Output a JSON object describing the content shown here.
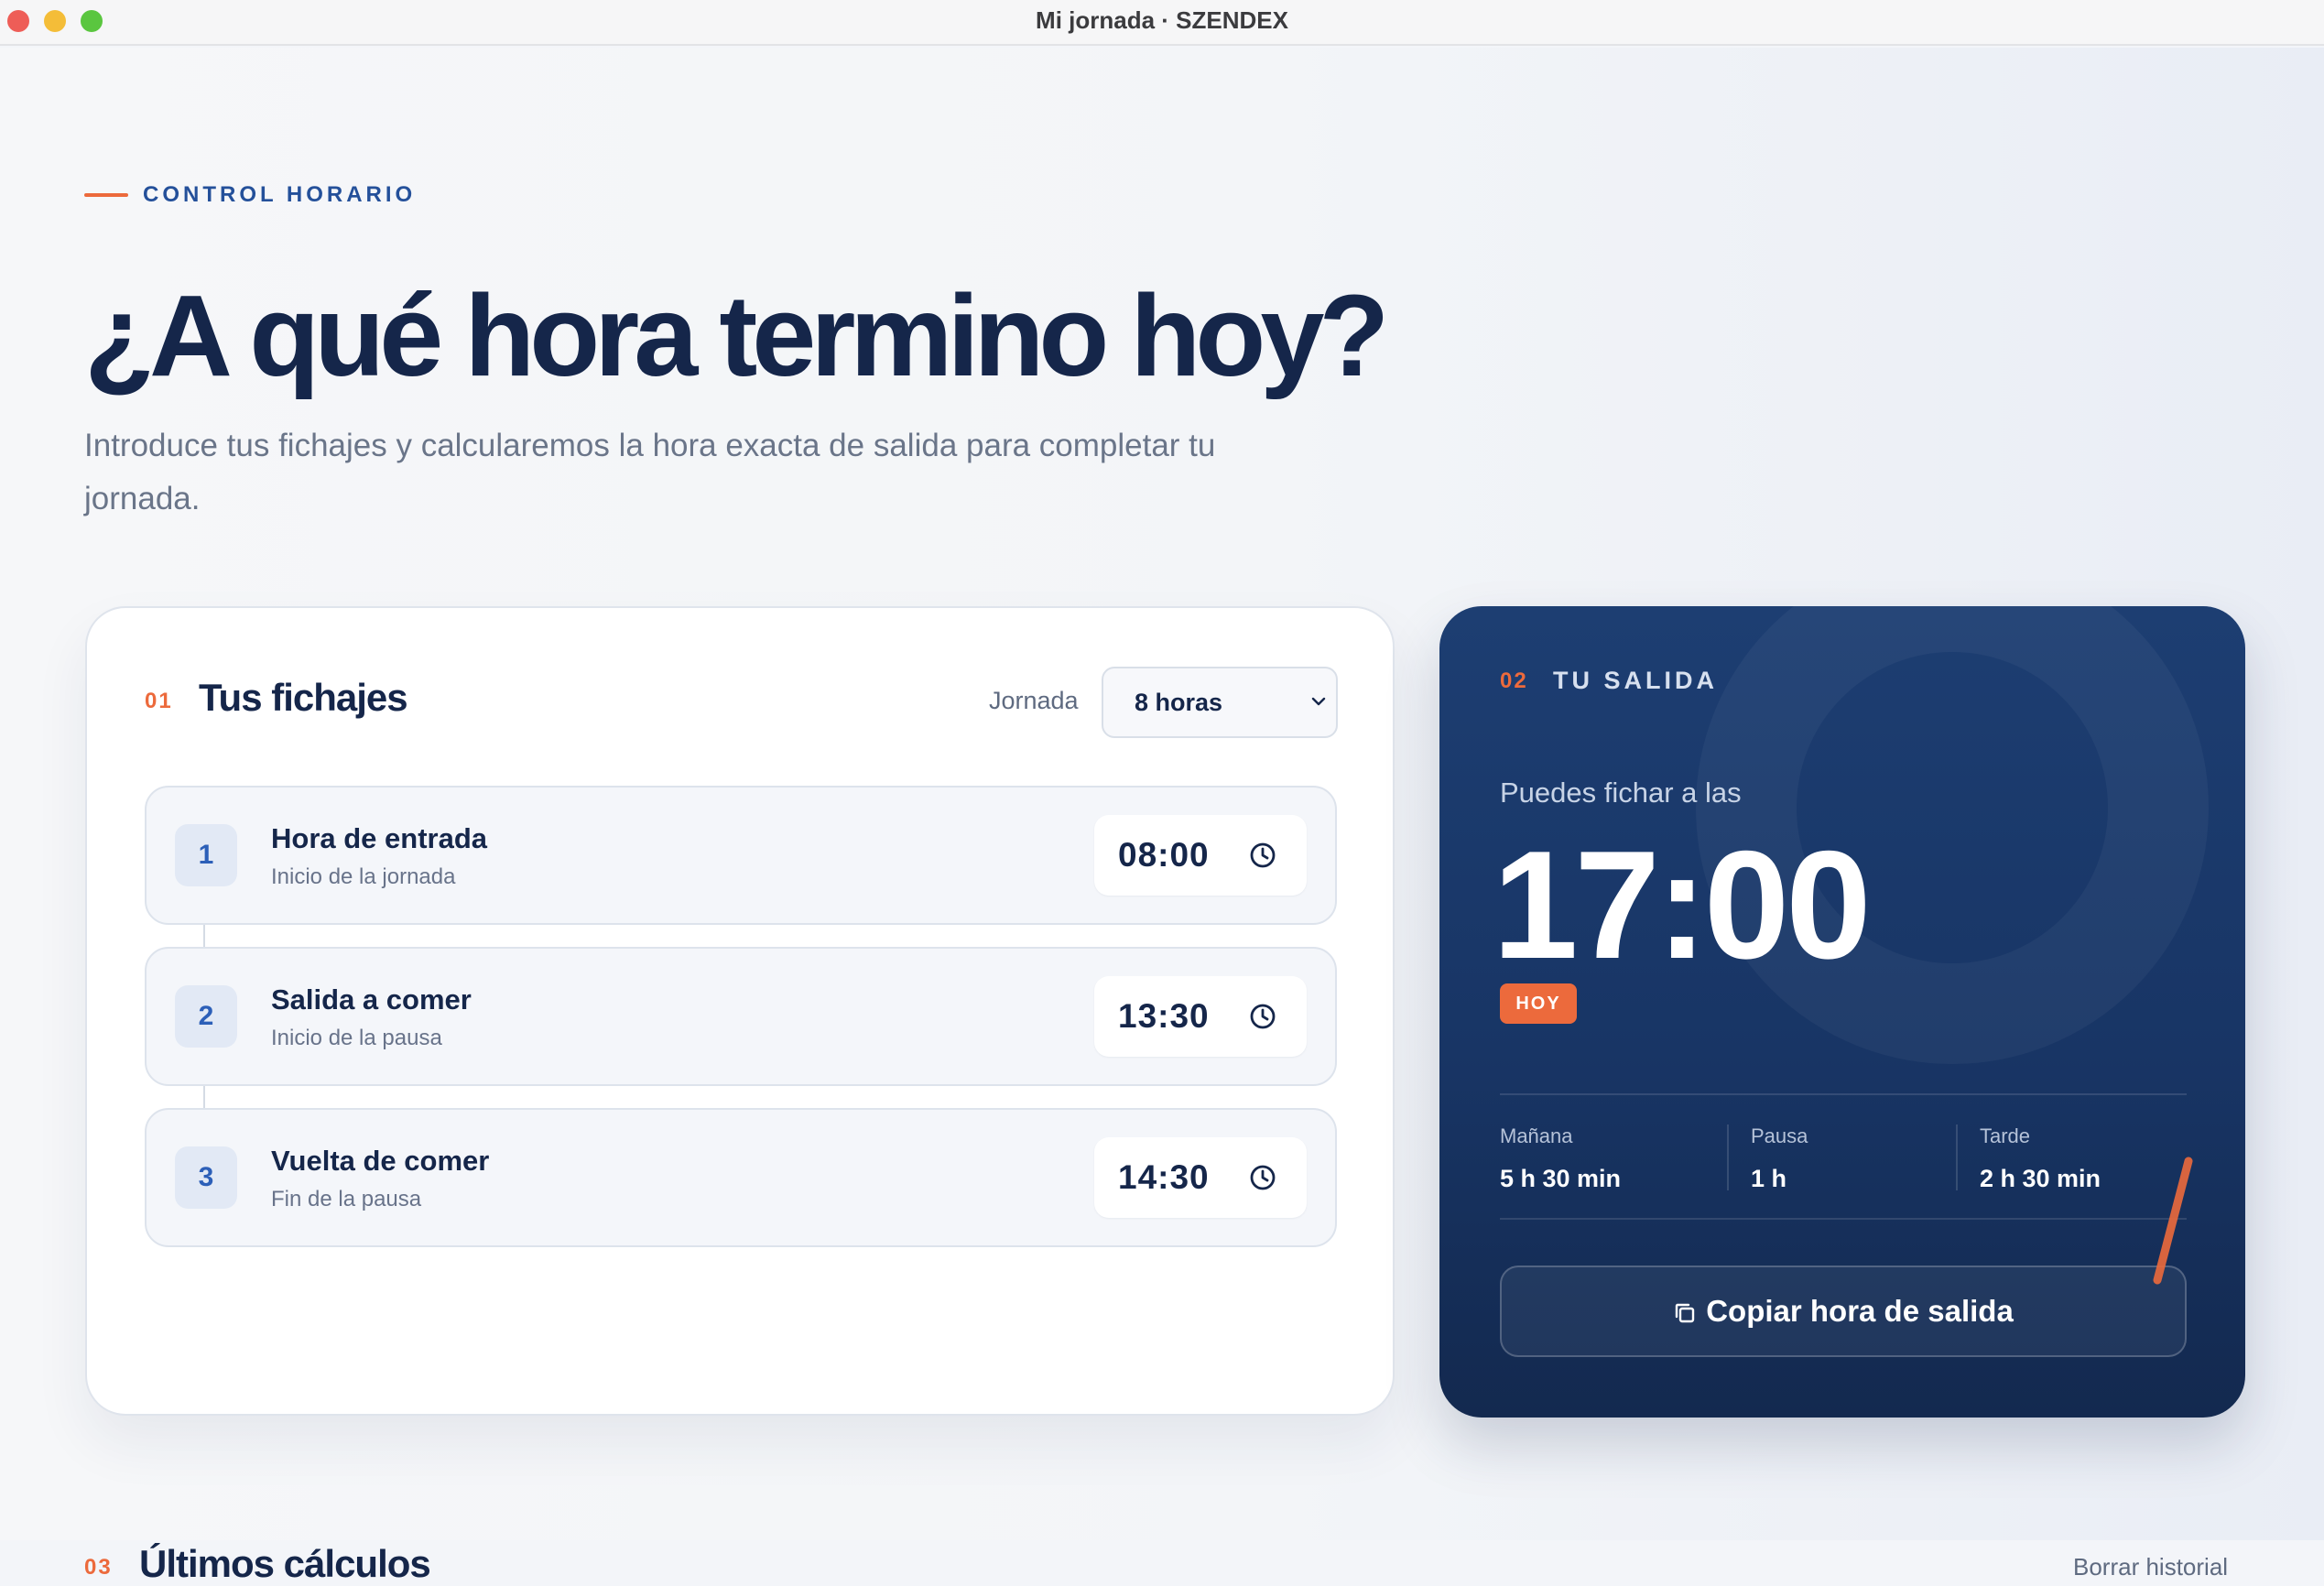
{
  "window": {
    "title": "Mi jornada · SZENDEX"
  },
  "hero": {
    "eyebrow": "CONTROL HORARIO",
    "headline": "¿A qué hora termino hoy?",
    "subtitle": "Introduce tus fichajes y calcularemos la hora exacta de salida para completar tu jornada."
  },
  "fichajes": {
    "number": "01",
    "title": "Tus fichajes",
    "jornada_label": "Jornada",
    "jornada_value": "8 horas",
    "rows": [
      {
        "num": "1",
        "title": "Hora de entrada",
        "subtitle": "Inicio de la jornada",
        "time": "08:00"
      },
      {
        "num": "2",
        "title": "Salida a comer",
        "subtitle": "Inicio de la pausa",
        "time": "13:30"
      },
      {
        "num": "3",
        "title": "Vuelta de comer",
        "subtitle": "Fin de la pausa",
        "time": "14:30"
      }
    ]
  },
  "salida": {
    "number": "02",
    "title": "TU SALIDA",
    "lead": "Puedes fichar a las",
    "time": "17:00",
    "badge": "HOY",
    "stats": [
      {
        "label": "Mañana",
        "value": "5 h 30 min"
      },
      {
        "label": "Pausa",
        "value": "1 h"
      },
      {
        "label": "Tarde",
        "value": "2 h 30 min"
      }
    ],
    "copy_button": "Copiar hora de salida"
  },
  "historial": {
    "number": "03",
    "title": "Últimos cálculos",
    "clear_label": "Borrar historial"
  },
  "colors": {
    "accent": "#ec6a3c",
    "navy": "#15264a",
    "brand_blue": "#24509a",
    "panel_bg": "#1d3e72"
  }
}
